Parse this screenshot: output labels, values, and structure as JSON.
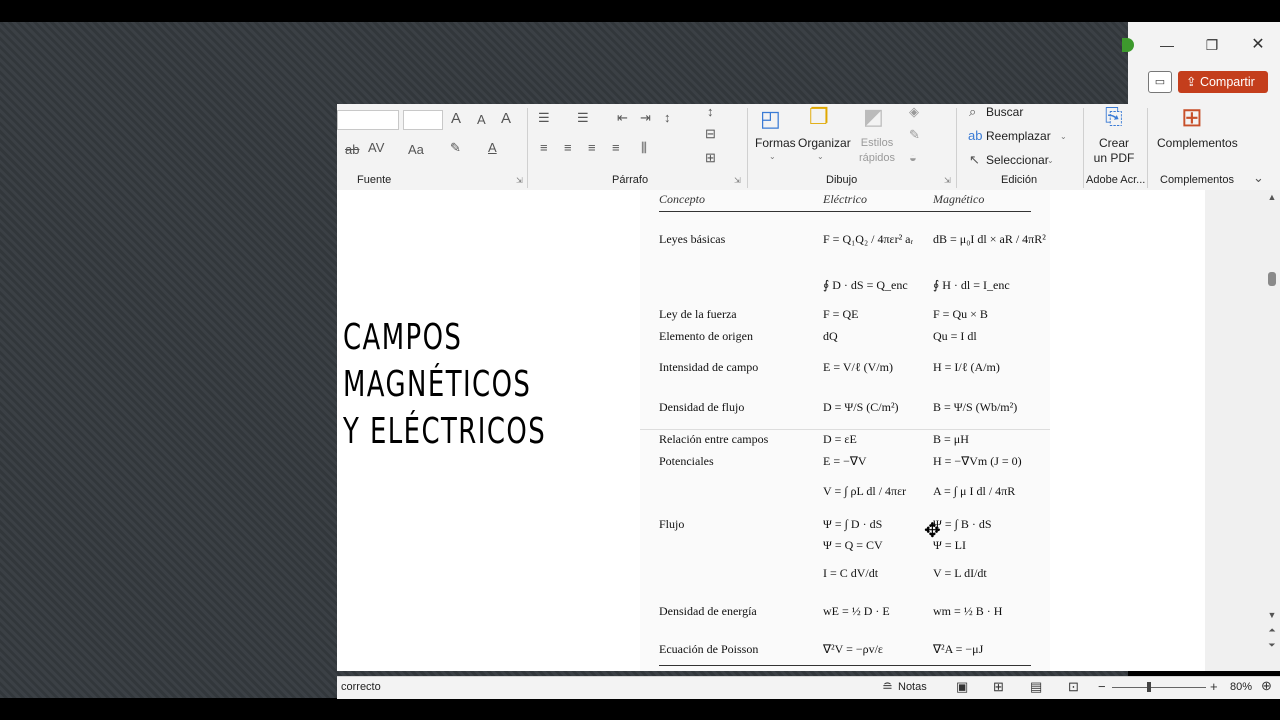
{
  "ribbon": {
    "groups": {
      "font": "Fuente",
      "paragraph": "Párrafo",
      "drawing": "Dibujo",
      "editing": "Edición",
      "adobe": "Adobe Acr...",
      "addins": "Complementos"
    },
    "buttons": {
      "shapes": "Formas",
      "arrange": "Organizar",
      "quick_styles": "Estilos rápidos",
      "find": "Buscar",
      "replace": "Reemplazar",
      "select": "Seleccionar",
      "create_pdf": "Crear un PDF",
      "addins": "Complementos"
    }
  },
  "window": {
    "share": "Compartir"
  },
  "slide": {
    "title_lines": [
      "CAMPOS",
      "MAGNÉTICOS",
      "Y ELÉCTRICOS"
    ]
  },
  "table": {
    "headers": [
      "Concepto",
      "Eléctrico",
      "Magnético"
    ],
    "rows": [
      {
        "concept": "Leyes básicas",
        "electric": "F = Q₁Q₂ / 4πεr² aᵣ",
        "magnetic": "dB = μ₀I dl × aR / 4πR²"
      },
      {
        "concept": "",
        "electric": "∮ D · dS = Q_enc",
        "magnetic": "∮ H · dl = I_enc"
      },
      {
        "concept": "Ley de la fuerza",
        "electric": "F = QE",
        "magnetic": "F = Qu × B"
      },
      {
        "concept": "Elemento de origen",
        "electric": "dQ",
        "magnetic": "Qu = I dl"
      },
      {
        "concept": "Intensidad de campo",
        "electric": "E = V/ℓ (V/m)",
        "magnetic": "H = I/ℓ (A/m)"
      },
      {
        "concept": "Densidad de flujo",
        "electric": "D = Ψ/S (C/m²)",
        "magnetic": "B = Ψ/S (Wb/m²)"
      },
      {
        "concept": "Relación entre campos",
        "electric": "D = εE",
        "magnetic": "B = μH"
      },
      {
        "concept": "Potenciales",
        "electric": "E = −∇V",
        "magnetic": "H = −∇Vm (J = 0)"
      },
      {
        "concept": "",
        "electric": "V = ∫ ρL dl / 4πεr",
        "magnetic": "A = ∫ μ I dl / 4πR"
      },
      {
        "concept": "Flujo",
        "electric": "Ψ = ∫ D · dS",
        "magnetic": "Ψ = ∫ B · dS"
      },
      {
        "concept": "",
        "electric": "Ψ = Q = CV",
        "magnetic": "Ψ = LI"
      },
      {
        "concept": "",
        "electric": "I = C dV/dt",
        "magnetic": "V = L dI/dt"
      },
      {
        "concept": "Densidad de energía",
        "electric": "wE = ½ D · E",
        "magnetic": "wm = ½ B · H"
      },
      {
        "concept": "Ecuación de Poisson",
        "electric": "∇²V = −ρv/ε",
        "magnetic": "∇²A = −μJ"
      }
    ]
  },
  "statusbar": {
    "left": "correcto",
    "notes": "Notas",
    "zoom": "80%"
  },
  "colors": {
    "share_button": "#c43e1c",
    "ribbon_bg": "#f3f3f3"
  }
}
